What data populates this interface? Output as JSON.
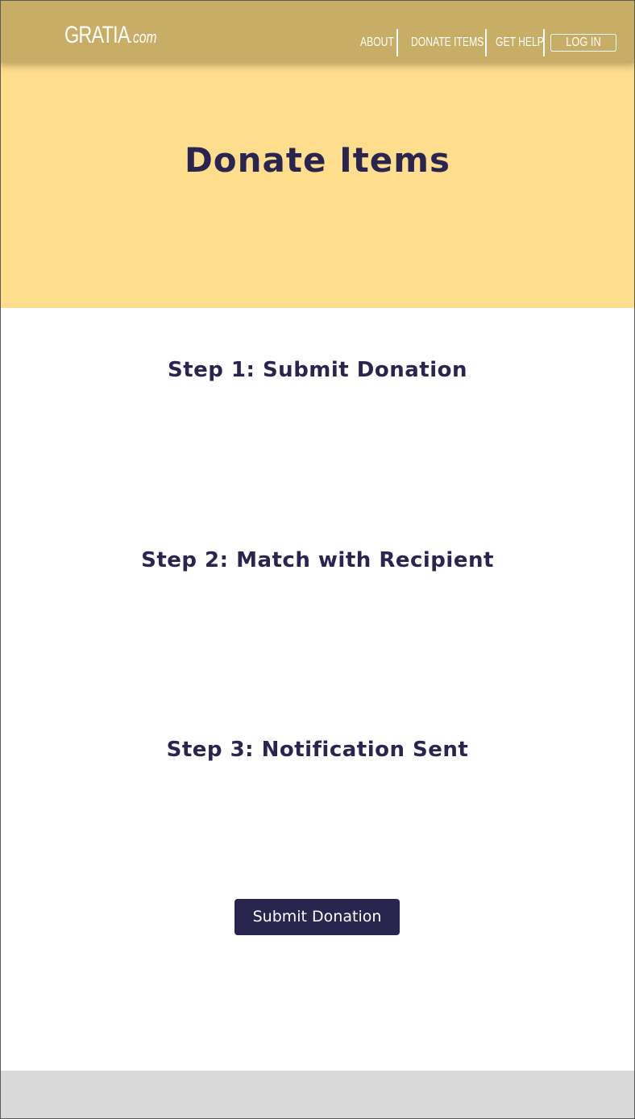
{
  "header": {
    "logo_main": "GRATIA",
    "logo_suffix": ".com",
    "nav": {
      "about": "ABOUT",
      "donate_items": "DONATE ITEMS",
      "get_help": "GET HELP",
      "log_in": "LOG IN"
    }
  },
  "hero": {
    "title": "Donate Items"
  },
  "steps": [
    "Step 1: Submit Donation",
    "Step 2: Match with Recipient",
    "Step 3: Notification Sent"
  ],
  "cta": {
    "submit_label": "Submit Donation"
  },
  "colors": {
    "header_bg": "#c8ad66",
    "hero_bg": "#fede8c",
    "text_navy": "#2a2550",
    "button_bg": "#28254f",
    "footer_bg": "#d9d9d9"
  }
}
